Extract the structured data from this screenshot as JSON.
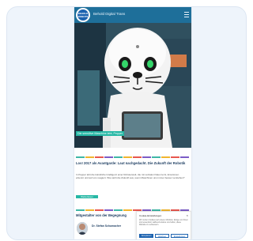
{
  "header": {
    "logo_text": "BEHOLD ROBOTS",
    "site_name": "Behold Digital Trans"
  },
  "hero": {
    "caption": "Die sensitive Maschine lebt, Pepper"
  },
  "article": {
    "title": "Los! 2017 als Avantgarde: Laut nachgedacht. Die Zukunft der Robotik",
    "body": "In Pepper lebt die künstliche Intelligenz einer Roboterwelt, die mit sozialen Daten lernt, Emotionen erkennt und auf uns reagiert. Wie sieht die Zukunft aus, wenn Maschinen uns immer besser verstehen?",
    "read_more": "Weiterlesen"
  },
  "section": {
    "title": "Mitgestalter von der Begegnung"
  },
  "person": {
    "name": "Dr. Stefan Schumacher"
  },
  "cookie": {
    "title": "Cookie-Einstellungen",
    "text": "Wir nutzen Cookies auf unserer Website. Einige von ihnen sind essenziell, während andere uns helfen, diese Website zu verbessern.",
    "accept": "Akzeptieren",
    "deny": "Ablehnen",
    "settings": "Einstellungen"
  },
  "colors": {
    "header": "#1e6f9a",
    "accent": "#26b8a5",
    "stripe": [
      "#3fb7a6",
      "#f1b52f",
      "#e8574f",
      "#7c5cc6",
      "#3fb7a6",
      "#f1b52f",
      "#e8574f",
      "#7c5cc6",
      "#3fb7a6",
      "#f1b52f",
      "#e8574f",
      "#7c5cc6"
    ]
  }
}
